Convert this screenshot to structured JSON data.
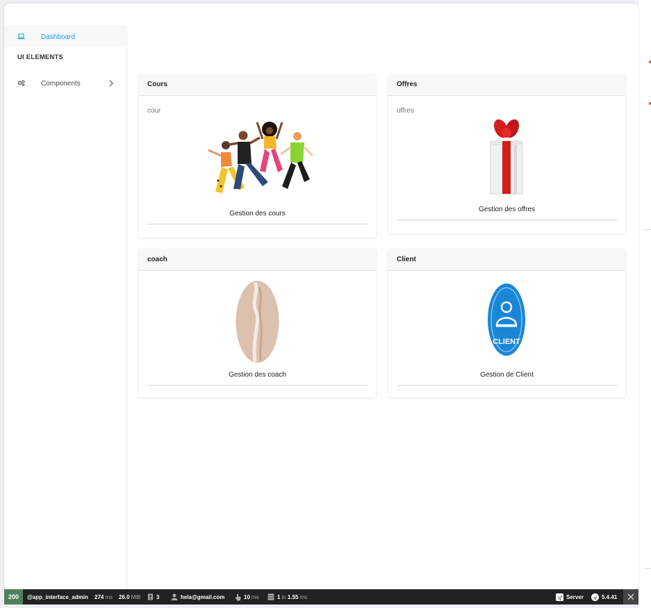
{
  "sidebar": {
    "dashboard_label": "Dashboard",
    "section_title": "UI ELEMENTS",
    "components_label": "Components"
  },
  "cards": {
    "cours": {
      "title": "Cours",
      "subtitle": "cour",
      "caption": "Gestion des cours"
    },
    "offres": {
      "title": "Offres",
      "subtitle": "offres",
      "caption": "Gestion des offres"
    },
    "coach": {
      "title": "coach",
      "caption": "Gestion des coach"
    },
    "client": {
      "title": "Client",
      "caption": "Gestion de Client",
      "badge_text": "CLIENT"
    }
  },
  "toolbar": {
    "status_code": "200",
    "route": "@app_interface_admin",
    "time_value": "274",
    "time_unit": "ms",
    "memory_value": "26.0",
    "memory_unit": "MiB",
    "logs_count": "3",
    "user": "hela@gmail.com",
    "events_value": "10",
    "events_unit": "ms",
    "db_queries": "1",
    "db_in": "in",
    "db_time": "1.55",
    "db_unit": "ms",
    "server_label": "Server",
    "version": "5.4.41"
  },
  "colors": {
    "accent": "#1d9bd6",
    "status_ok": "#4f805d",
    "toolbar_bg": "#222222"
  }
}
